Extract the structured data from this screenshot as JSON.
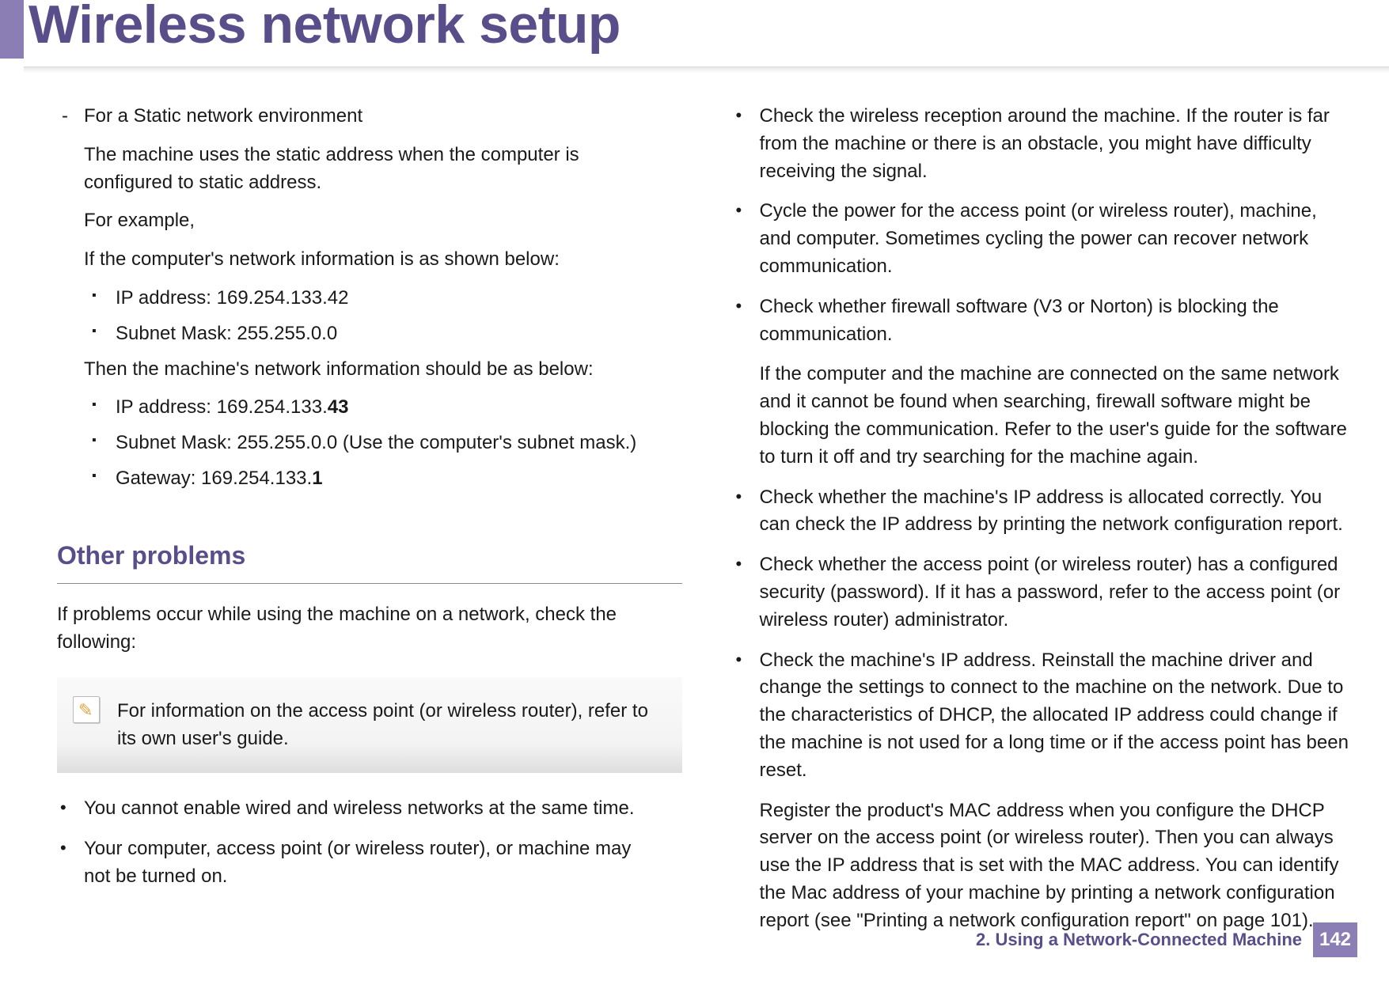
{
  "header": {
    "title": "Wireless network setup"
  },
  "left": {
    "static_env_head": "For a Static network environment",
    "static_env_p1": "The machine uses the static address when the computer is configured to static address.",
    "static_env_p2": "For example,",
    "static_env_p3": "If the computer's network information is as shown below:",
    "ip_comp": "IP address: 169.254.133.42",
    "subnet_comp": "Subnet Mask: 255.255.0.0",
    "then_line": "Then the machine's network information should be as below:",
    "ip_machine_pre": "IP address: 169.254.133.",
    "ip_machine_bold": "43",
    "subnet_machine": "Subnet Mask: 255.255.0.0 (Use the computer's subnet mask.)",
    "gateway_pre": "Gateway: 169.254.133.",
    "gateway_bold": "1",
    "other_problems_head": "Other problems",
    "other_problems_intro": "If problems occur while using the machine on a network, check the following:",
    "note_text": "For information on the access point (or wireless router), refer to its own user's guide.",
    "bullet1": "You cannot enable wired and wireless networks at the same time.",
    "bullet2": "Your computer, access point (or wireless router), or machine may not be turned on."
  },
  "right": {
    "b1": "Check the wireless reception around the machine. If the router is far from the machine or there is an obstacle, you might have difficulty receiving the signal.",
    "b2": "Cycle the power for the access point (or wireless router), machine, and computer. Sometimes cycling the power can recover network communication.",
    "b3": "Check whether firewall software (V3 or Norton) is blocking the communication.",
    "b3_sub": "If the computer and the machine are connected on the same network and it cannot be found when searching, firewall software might be blocking the communication. Refer to the user's guide for the software to turn it off and try searching for the machine again.",
    "b4": "Check whether the machine's IP address is allocated correctly. You can check the IP address by printing the network configuration report.",
    "b5": "Check whether the access point (or wireless router) has a configured security (password). If it has a password, refer to the access point (or wireless router) administrator.",
    "b6": "Check the machine's IP address. Reinstall the machine driver and change the settings to connect to the machine on the network. Due to the characteristics of DHCP, the allocated IP address could change if the machine is not used for a long time or if the access point has been reset.",
    "b6_sub": "Register the product's MAC address when you configure the DHCP server on the access point (or wireless router). Then you can always use the IP address that is set with the MAC address. You can identify the Mac address of your machine by printing a network configuration report (see \"Printing a network configuration report\" on page 101)."
  },
  "footer": {
    "chapter": "2.  Using a Network-Connected Machine",
    "page": "142"
  }
}
